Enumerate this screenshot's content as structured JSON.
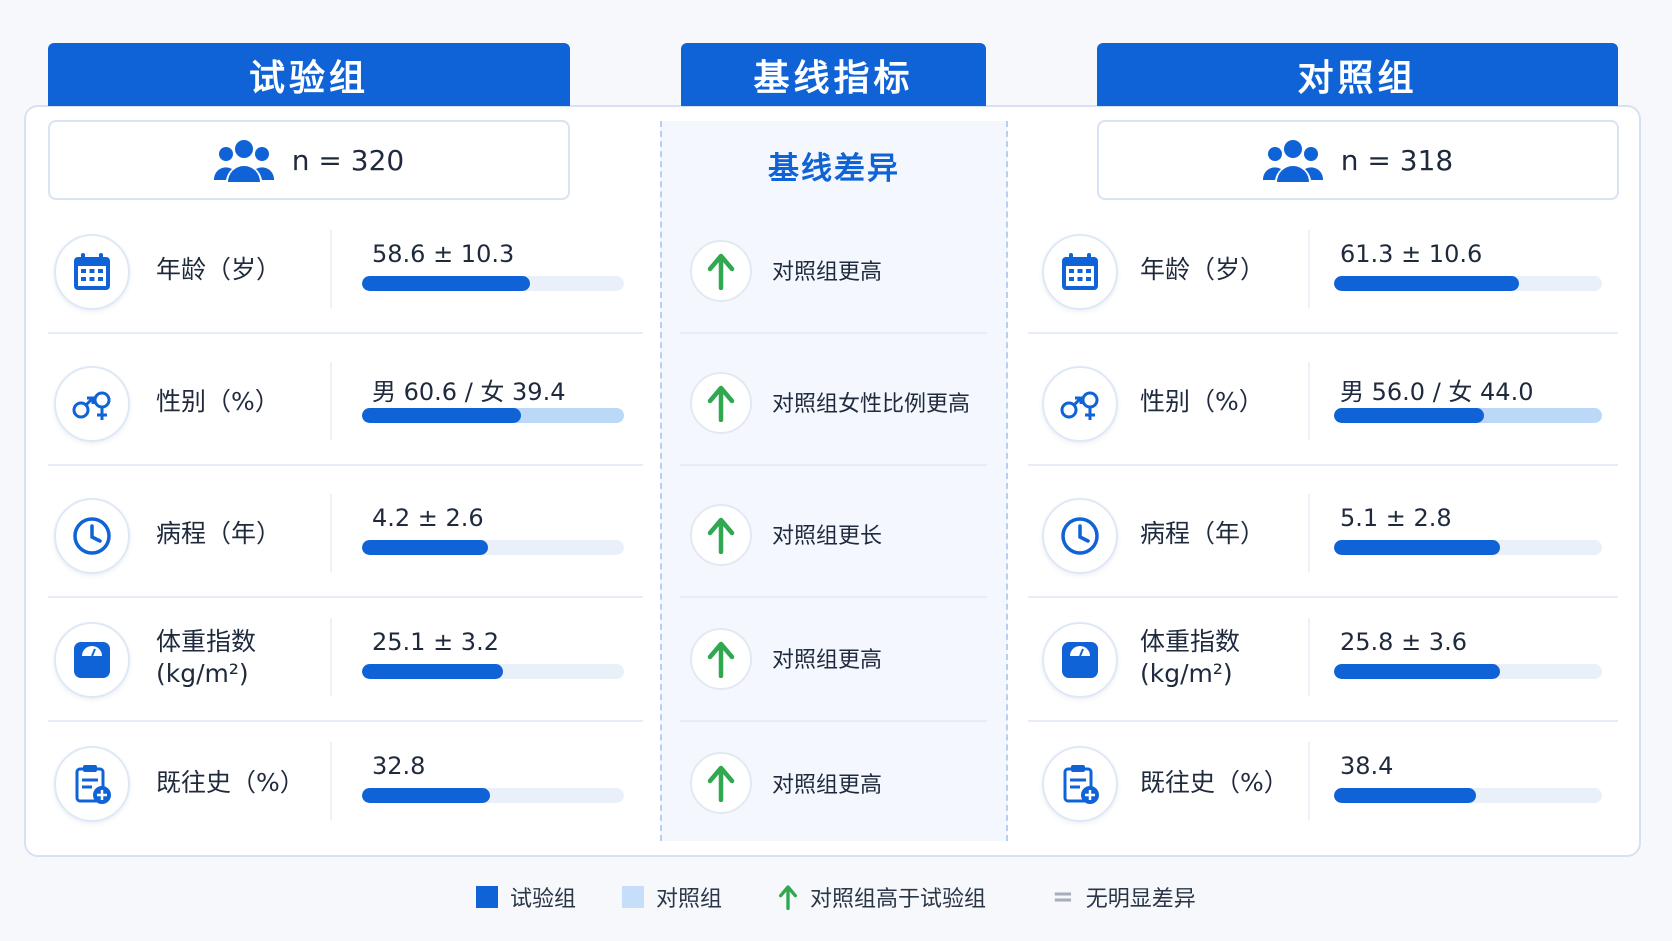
{
  "headers": {
    "trial": "试验组",
    "baseline": "基线指标",
    "control": "对照组"
  },
  "colors": {
    "primary": "#0f63d6",
    "light": "#c6defa",
    "arrow": "#2fa84f",
    "neutral": "#a6adb8"
  },
  "trial": {
    "n_label": "n = 320",
    "n_icon": "group-icon",
    "rows": [
      {
        "label": "年龄（岁）",
        "icon": "calendar-icon",
        "value": "58.6 ± 10.3",
        "fill_fraction": 0.64
      },
      {
        "label": "性别（%）",
        "icon": "gender-icon",
        "value": "男 60.6 / 女 39.4",
        "fill_fraction": 0.606
      },
      {
        "label": "病程（年）",
        "icon": "clock-icon",
        "value": "4.2 ± 2.6",
        "fill_fraction": 0.48
      },
      {
        "label": "体重指数\n(kg/m²)",
        "icon": "scale-icon",
        "value": "25.1 ± 3.2",
        "fill_fraction": 0.54
      },
      {
        "label": "既往史（%）",
        "icon": "clipboard-plus-icon",
        "value": "32.8",
        "fill_fraction": 0.49
      }
    ]
  },
  "control": {
    "n_label": "n = 318",
    "n_icon": "group-icon",
    "rows": [
      {
        "label": "年龄（岁）",
        "icon": "calendar-icon",
        "value": "61.3 ± 10.6",
        "fill_fraction": 0.69
      },
      {
        "label": "性别（%）",
        "icon": "gender-icon",
        "value": "男 56.0 / 女 44.0",
        "fill_fraction": 0.56
      },
      {
        "label": "病程（年）",
        "icon": "clock-icon",
        "value": "5.1 ± 2.8",
        "fill_fraction": 0.62
      },
      {
        "label": "体重指数\n(kg/m²)",
        "icon": "scale-icon",
        "value": "25.8 ± 3.6",
        "fill_fraction": 0.62
      },
      {
        "label": "既往史（%）",
        "icon": "clipboard-plus-icon",
        "value": "38.4",
        "fill_fraction": 0.53
      }
    ]
  },
  "baseline": {
    "title": "基线差异",
    "rows": [
      {
        "text": "对照组更高",
        "icon": "arrow-up-icon"
      },
      {
        "text": "对照组女性比例更高",
        "icon": "arrow-up-icon"
      },
      {
        "text": "对照组更长",
        "icon": "arrow-up-icon"
      },
      {
        "text": "对照组更高",
        "icon": "arrow-up-icon"
      },
      {
        "text": "对照组更高",
        "icon": "arrow-up-icon"
      }
    ]
  },
  "legend": {
    "trial": "试验组",
    "control": "对照组",
    "higher": "对照组高于试验组",
    "none_symbol": "=",
    "none": "无明显差异"
  }
}
